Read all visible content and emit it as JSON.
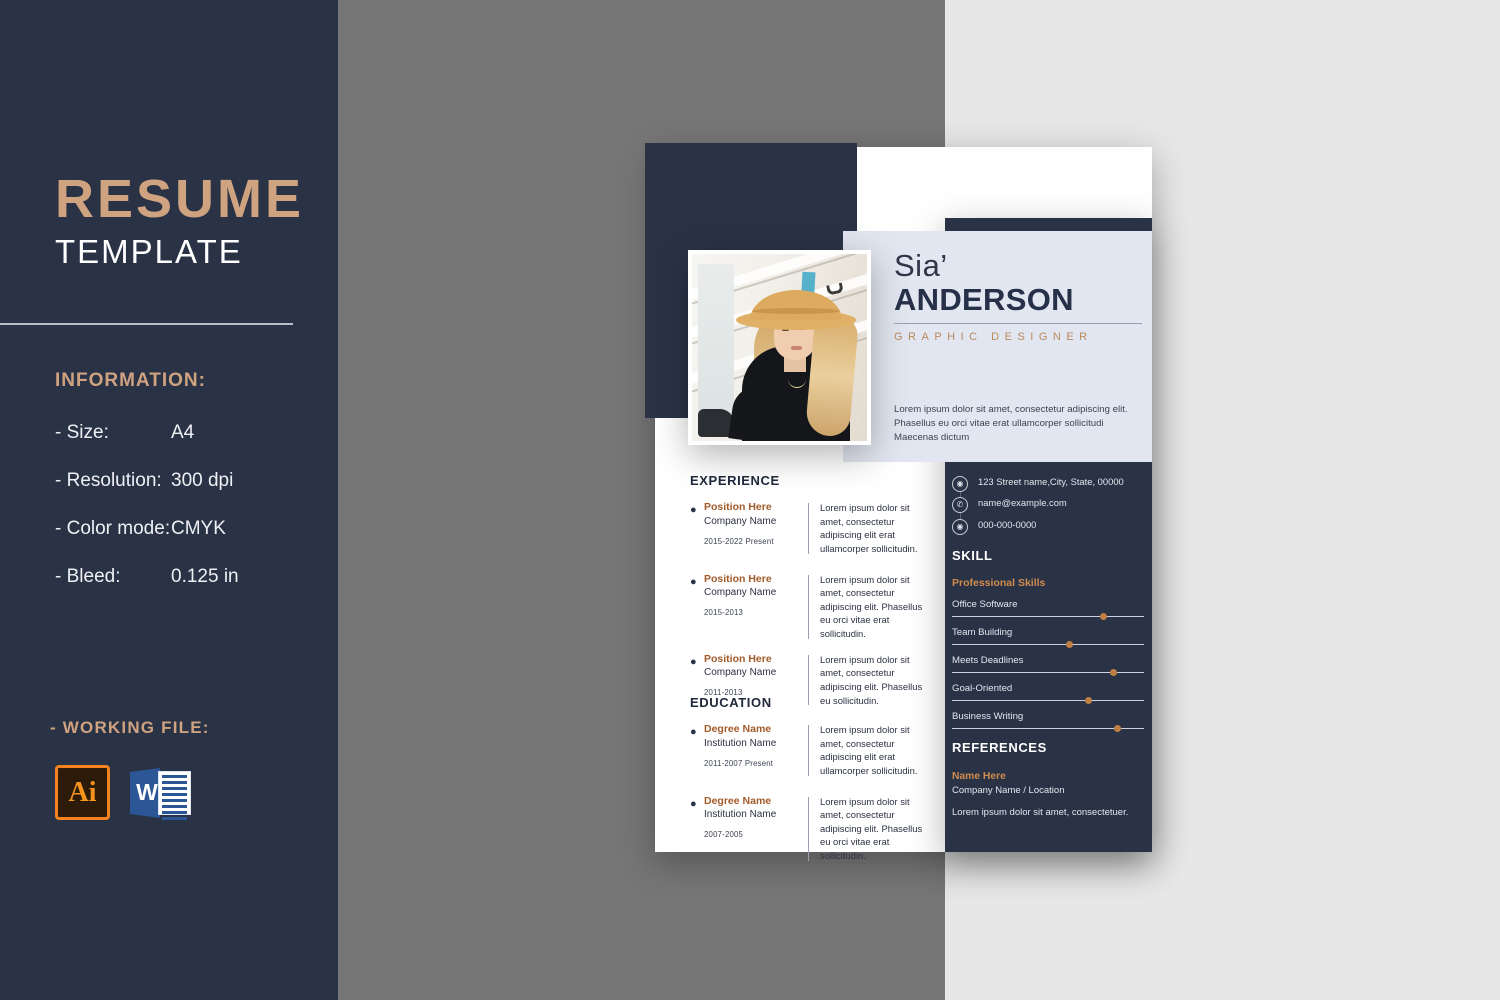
{
  "background": {
    "navy": "#2a3346",
    "gray": "#767676",
    "light": "#e7e7e7",
    "accent": "#cfa280"
  },
  "left_panel": {
    "title_line1": "RESUME",
    "title_line2": "TEMPLATE",
    "info_heading": "INFORMATION:",
    "info_rows": [
      {
        "key": "- Size:",
        "value": "A4"
      },
      {
        "key": "- Resolution:",
        "value": "300 dpi"
      },
      {
        "key": "- Color mode:",
        "value": "CMYK"
      },
      {
        "key": "- Bleed:",
        "value": "0.125 in"
      }
    ],
    "working_file_label": "- WORKING FILE:",
    "file_icons": [
      {
        "name": "illustrator-icon",
        "label": "Ai"
      },
      {
        "name": "word-icon",
        "label": "W"
      }
    ]
  },
  "resume": {
    "header": {
      "first_name": "Sia’",
      "last_name": "ANDERSON",
      "role": "GRAPHIC DESIGNER",
      "bio": "Lorem ipsum dolor sit amet, consectetur adipiscing elit. Phasellus eu orci vitae erat ullamcorper sollicitudi Maecenas dictum"
    },
    "experience": {
      "title": "EXPERIENCE",
      "entries": [
        {
          "position": "Position Here",
          "company": "Company Name",
          "date": "2015-2022 Present",
          "description": "Lorem ipsum dolor sit amet, consectetur adipiscing elit erat ullamcorper sollicitudin."
        },
        {
          "position": "Position Here",
          "company": "Company Name",
          "date": "2015-2013",
          "description": "Lorem ipsum dolor sit amet, consectetur adipiscing elit. Phasellus eu orci vitae erat sollicitudin."
        },
        {
          "position": "Position Here",
          "company": "Company Name",
          "date": "2011-2013",
          "description": "Lorem ipsum dolor sit amet, consectetur adipiscing elit. Phasellus eu sollicitudin."
        }
      ]
    },
    "education": {
      "title": "EDUCATION",
      "entries": [
        {
          "position": "Degree Name",
          "company": "Institution Name",
          "date": "2011-2007 Present",
          "description": "Lorem ipsum dolor sit amet, consectetur adipiscing elit erat ullamcorper sollicitudin."
        },
        {
          "position": "Degree Name",
          "company": "Institution Name",
          "date": "2007-2005",
          "description": "Lorem ipsum dolor sit amet, consectetur adipiscing elit. Phasellus eu orci vitae erat sollicitudin."
        }
      ]
    },
    "contact": [
      {
        "icon": "location-pin-icon",
        "glyph": "◉",
        "text": "123 Street name,City, State, 00000"
      },
      {
        "icon": "phone-icon",
        "glyph": "✆",
        "text": "name@example.com"
      },
      {
        "icon": "globe-icon",
        "glyph": "◉",
        "text": "000-000-0000"
      }
    ],
    "skill": {
      "title": "SKILL",
      "subtitle": "Professional Skills",
      "items": [
        {
          "label": "Office Software",
          "level": 79
        },
        {
          "label": "Team Building",
          "level": 61
        },
        {
          "label": "Meets Deadlines",
          "level": 84
        },
        {
          "label": "Goal-Oriented",
          "level": 71
        },
        {
          "label": "Business Writing",
          "level": 86
        }
      ]
    },
    "references": {
      "title": "REFERENCES",
      "name": "Name Here",
      "org": "Company Name / Location",
      "text": "Lorem ipsum dolor sit amet, consectetuer."
    }
  }
}
